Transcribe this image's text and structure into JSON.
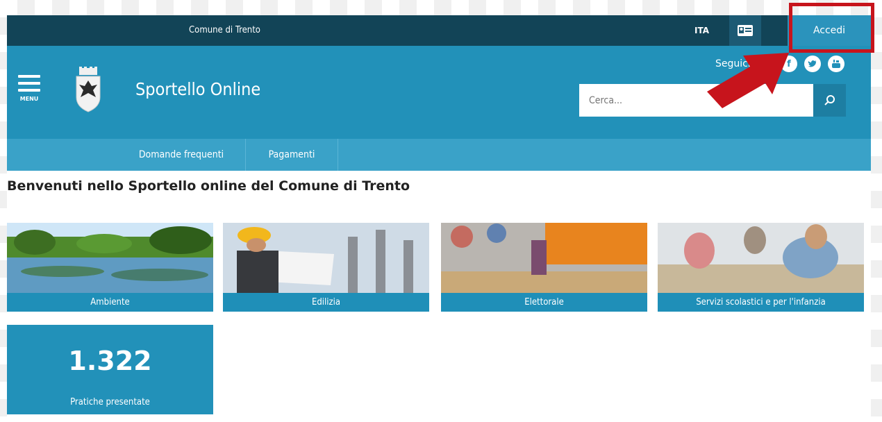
{
  "topbar": {
    "entity": "Comune di Trento",
    "language": "ITA",
    "card_icon": "id-card-icon",
    "login_label": "Accedi"
  },
  "header": {
    "menu_label": "MENU",
    "site_title": "Sportello Online",
    "follow_label": "Seguici",
    "social": [
      "facebook-icon",
      "twitter-icon",
      "youtube-icon"
    ],
    "search_placeholder": "Cerca...",
    "search_icon": "search-icon"
  },
  "nav": {
    "items": [
      "Domande frequenti",
      "Pagamenti"
    ]
  },
  "main": {
    "welcome": "Benvenuti nello Sportello online del Comune di Trento",
    "tiles": [
      "Ambiente",
      "Edilizia",
      "Elettorale",
      "Servizi scolastici e per l'infanzia"
    ],
    "stat": {
      "value": "1.322",
      "label": "Pratiche presentate"
    }
  },
  "colors": {
    "topbar": "#124457",
    "header": "#2291b9",
    "nav": "#3aa2c8",
    "annotation": "#c7141c"
  }
}
